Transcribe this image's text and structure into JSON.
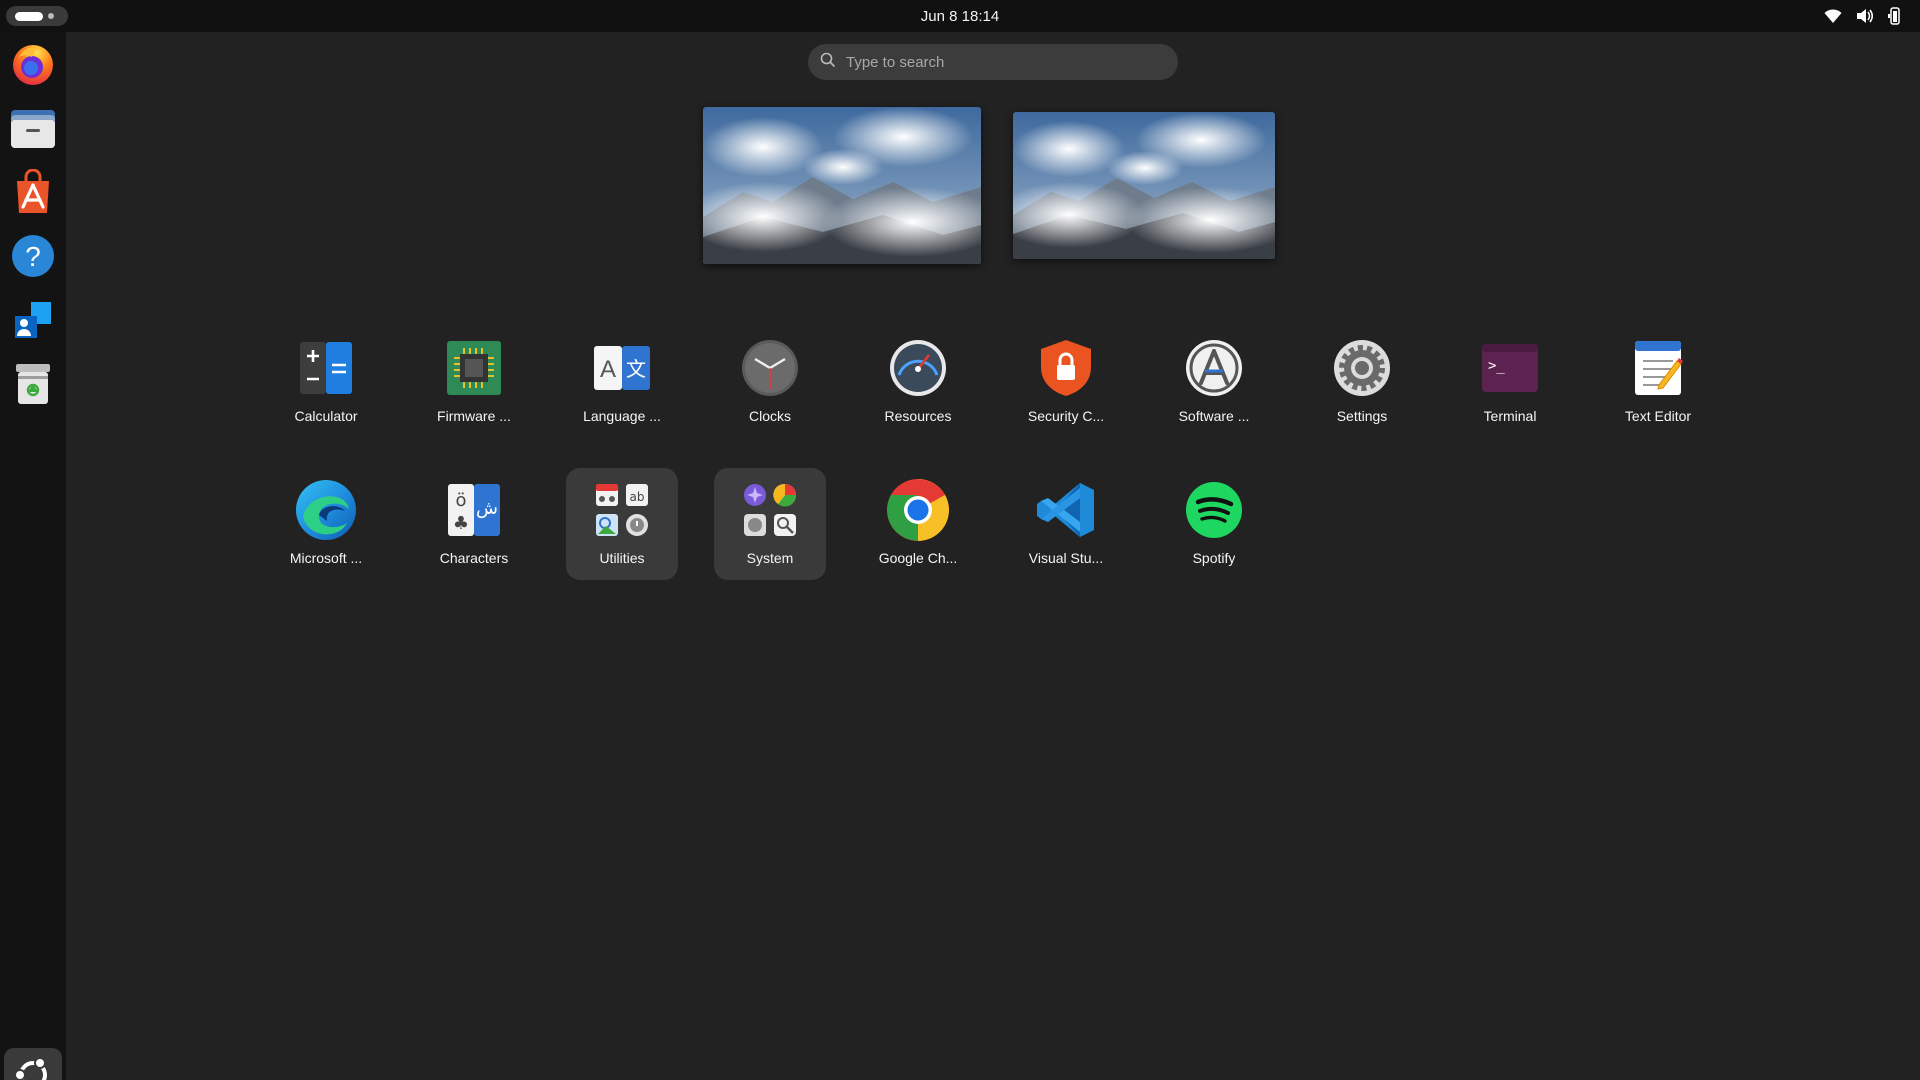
{
  "topbar": {
    "datetime": "Jun 8  18:14",
    "tray_icons": [
      "wifi-icon",
      "volume-icon",
      "battery-icon"
    ]
  },
  "dock": {
    "items": [
      "firefox",
      "files",
      "app-center",
      "help",
      "remote-desktop",
      "trash"
    ],
    "show_apps_icon": "ubuntu-logo-icon"
  },
  "search": {
    "placeholder": "Type to search"
  },
  "workspaces": 2,
  "apps": {
    "row1": [
      {
        "label": "Calculator",
        "icon": "calculator-icon"
      },
      {
        "label": "Firmware ...",
        "icon": "firmware-icon"
      },
      {
        "label": "Language ...",
        "icon": "language-icon"
      },
      {
        "label": "Clocks",
        "icon": "clock-icon"
      },
      {
        "label": "Resources",
        "icon": "resources-gauge-icon"
      },
      {
        "label": "Security C...",
        "icon": "security-shield-icon"
      },
      {
        "label": "Software ...",
        "icon": "software-updater-icon"
      },
      {
        "label": "Settings",
        "icon": "settings-gear-icon"
      },
      {
        "label": "Terminal",
        "icon": "terminal-icon"
      },
      {
        "label": "Text Editor",
        "icon": "text-editor-icon"
      }
    ],
    "row2": [
      {
        "label": "Microsoft ...",
        "icon": "edge-icon"
      },
      {
        "label": "Characters",
        "icon": "characters-icon"
      },
      {
        "label": "Utilities",
        "icon": "folder-icon"
      },
      {
        "label": "System",
        "icon": "folder-icon"
      },
      {
        "label": "Google Ch...",
        "icon": "chrome-icon"
      },
      {
        "label": "Visual Stu...",
        "icon": "vscode-icon"
      },
      {
        "label": "Spotify",
        "icon": "spotify-icon"
      }
    ]
  }
}
